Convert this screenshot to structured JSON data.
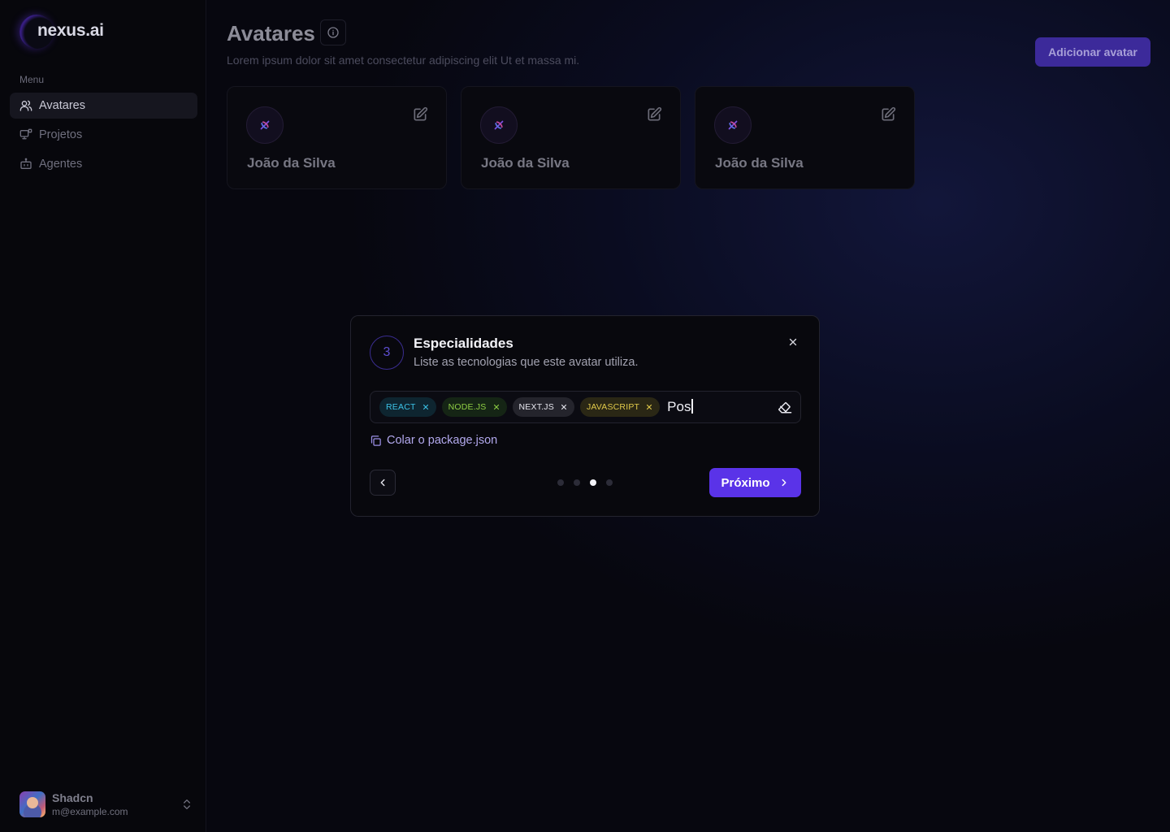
{
  "app": {
    "logo_text": "nexus.ai"
  },
  "sidebar": {
    "menu_label": "Menu",
    "items": [
      {
        "label": "Avatares",
        "icon": "users-icon",
        "active": true
      },
      {
        "label": "Projetos",
        "icon": "projects-icon",
        "active": false
      },
      {
        "label": "Agentes",
        "icon": "bot-icon",
        "active": false
      }
    ],
    "user": {
      "name": "Shadcn",
      "email": "m@example.com"
    }
  },
  "header": {
    "title": "Avatares",
    "subtitle": "Lorem ipsum dolor sit amet consectetur adipiscing elit Ut et massa mi.",
    "add_button": "Adicionar avatar"
  },
  "cards": [
    {
      "name": "João da Silva"
    },
    {
      "name": "João da Silva"
    },
    {
      "name": "João da Silva"
    }
  ],
  "modal": {
    "step": "3",
    "title": "Especialidades",
    "description": "Liste as tecnologias que este avatar utiliza.",
    "tags": [
      {
        "label": "REACT",
        "color": "#3cc2e6"
      },
      {
        "label": "NODE.JS",
        "color": "#8fcf44"
      },
      {
        "label": "NEXT.JS",
        "color": "#e6e6ee"
      },
      {
        "label": "JAVASCRIPT",
        "color": "#e0c94a"
      }
    ],
    "input_value": "Pos",
    "paste_link": "Colar o package.json",
    "total_steps": 4,
    "current_step_index": 2,
    "next_button": "Próximo"
  },
  "colors": {
    "accent": "#5a33e8",
    "background": "#07070f"
  }
}
